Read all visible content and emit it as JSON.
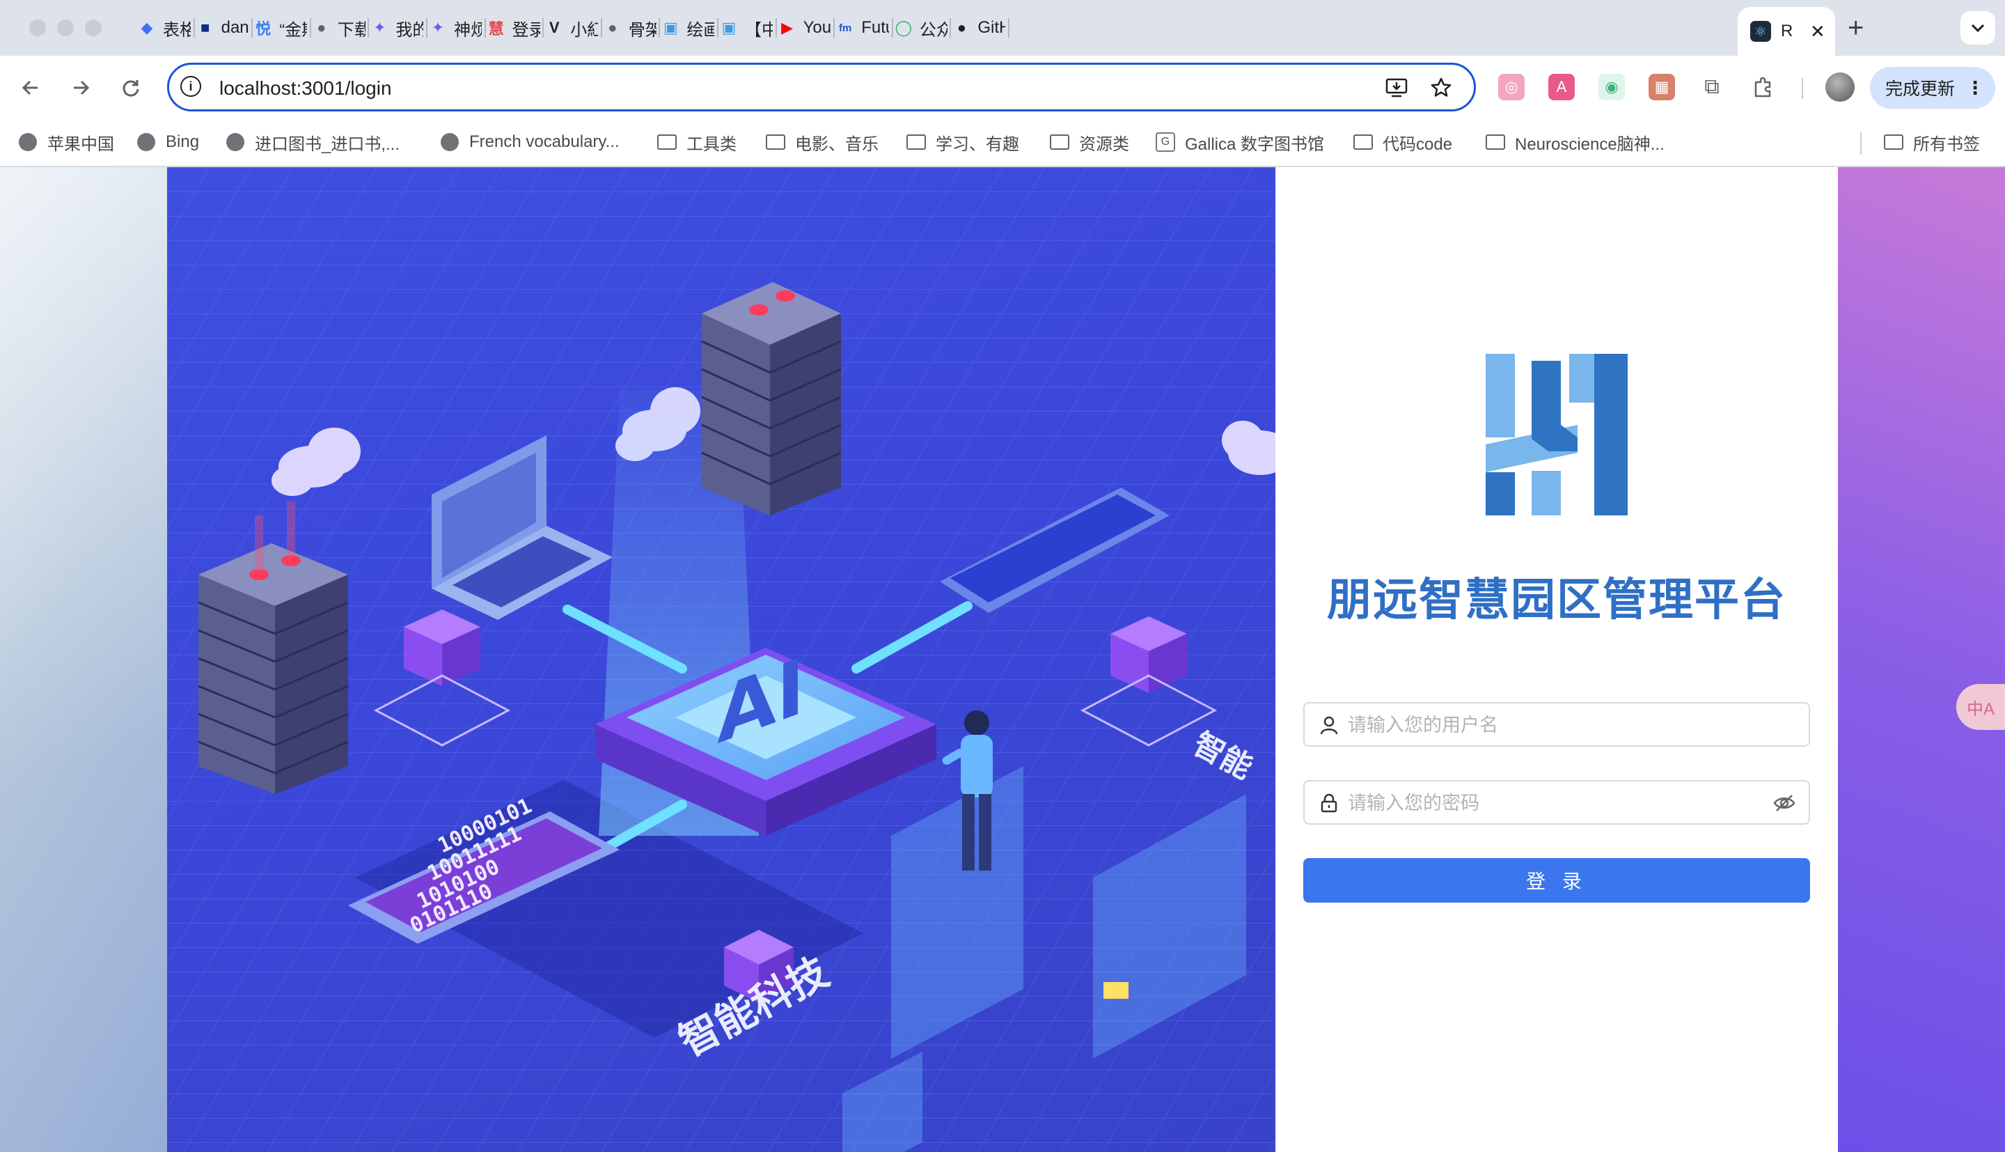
{
  "browser": {
    "tabs": [
      {
        "label": "表格",
        "icon": "diamond-icon",
        "color": "#3d6ef5"
      },
      {
        "label": "danie",
        "icon": "square-icon",
        "color": "#0b2c8a"
      },
      {
        "label": "“金斯",
        "icon": "yue-icon",
        "color": "#3c7ff0"
      },
      {
        "label": "下载:",
        "icon": "globe-icon",
        "color": "#5f6368"
      },
      {
        "label": "我的:",
        "icon": "swirl-icon",
        "color": "#6b5df0"
      },
      {
        "label": "神烦",
        "icon": "swirl-icon",
        "color": "#6b5df0"
      },
      {
        "label": "登录",
        "icon": "hui-icon",
        "color": "#e5484d"
      },
      {
        "label": "小紅",
        "icon": "v-icon",
        "color": "#1f1f1f"
      },
      {
        "label": "骨架",
        "icon": "globe-icon",
        "color": "#5f6368"
      },
      {
        "label": "绘画-",
        "icon": "tv-icon",
        "color": "#3d9ae0"
      },
      {
        "label": "【中",
        "icon": "tv-icon",
        "color": "#3d9ae0"
      },
      {
        "label": "You'r",
        "icon": "youtube-icon",
        "color": "#ff0000"
      },
      {
        "label": "Futur",
        "icon": "fm-icon",
        "color": "#1f4fd8"
      },
      {
        "label": "公众",
        "icon": "circle-icon",
        "color": "#2aae67"
      },
      {
        "label": "GitHu",
        "icon": "github-icon",
        "color": "#1f1f1f"
      }
    ],
    "active_tab": {
      "label": "R",
      "icon": "react-icon",
      "close": "✕"
    },
    "new_tab": "+",
    "tab_menu": "⌄",
    "url": "localhost:3001/login",
    "update_label": "完成更新",
    "update_dots": "⋮"
  },
  "bookmarks": {
    "items": [
      {
        "label": "苹果中国",
        "icon": "globe-icon"
      },
      {
        "label": "Bing",
        "icon": "globe-icon"
      },
      {
        "label": "进口图书_进口书,...",
        "icon": "globe-icon"
      },
      {
        "label": "French vocabulary...",
        "icon": "globe-icon"
      },
      {
        "label": "工具类",
        "icon": "folder-icon"
      },
      {
        "label": "电影、音乐",
        "icon": "folder-icon"
      },
      {
        "label": "学习、有趣",
        "icon": "folder-icon"
      },
      {
        "label": "资源类",
        "icon": "folder-icon"
      },
      {
        "label": "Gallica 数字图书馆",
        "icon": "gallica-icon"
      },
      {
        "label": "代码code",
        "icon": "folder-icon"
      },
      {
        "label": "Neuroscience脑神...",
        "icon": "folder-icon"
      }
    ],
    "all_bookmarks": "所有书签"
  },
  "login": {
    "title": "朋远智慧园区管理平台",
    "username_placeholder": "请输入您的用户名",
    "password_placeholder": "请输入您的密码",
    "submit_label": "登 录"
  },
  "illustration": {
    "text_main": "智能科技",
    "text_side": "智能",
    "binary_lines": [
      "10000101",
      "10011111",
      "1010100",
      "0101110"
    ]
  },
  "floating": {
    "translate_label": "中A"
  },
  "colors": {
    "accent": "#3b76ee",
    "title": "#2f6fc4",
    "logo_light": "#79b6ec",
    "logo_dark": "#2f73c3",
    "illustration_bg": "#3f4fe0"
  }
}
